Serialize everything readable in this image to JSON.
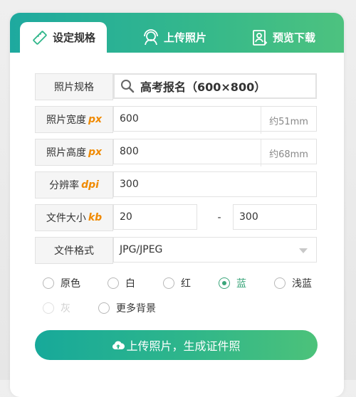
{
  "tabs": [
    {
      "label": "设定规格",
      "icon": "ruler-icon",
      "active": true
    },
    {
      "label": "上传照片",
      "icon": "avatar-upload-icon",
      "active": false
    },
    {
      "label": "预览下载",
      "icon": "id-photo-icon",
      "active": false
    }
  ],
  "form": {
    "spec": {
      "label": "照片规格",
      "value": "高考报名（600×800）",
      "icon": "search-icon"
    },
    "width": {
      "label": "照片宽度",
      "unit": "px",
      "value": "600",
      "note": "约51mm"
    },
    "height": {
      "label": "照片高度",
      "unit": "px",
      "value": "800",
      "note": "约68mm"
    },
    "resolution": {
      "label": "分辨率",
      "unit": "dpi",
      "value": "300"
    },
    "filesize": {
      "label": "文件大小",
      "unit": "kb",
      "min": "20",
      "sep": "-",
      "max": "300"
    },
    "format": {
      "label": "文件格式",
      "value": "JPG/JPEG",
      "icon": "caret-down-icon"
    }
  },
  "backgrounds": [
    {
      "label": "原色",
      "checked": false,
      "disabled": false
    },
    {
      "label": "白",
      "checked": false,
      "disabled": false
    },
    {
      "label": "红",
      "checked": false,
      "disabled": false
    },
    {
      "label": "蓝",
      "checked": true,
      "disabled": false
    },
    {
      "label": "浅蓝",
      "checked": false,
      "disabled": false
    },
    {
      "label": "灰",
      "checked": false,
      "disabled": true
    },
    {
      "label": "更多背景",
      "checked": false,
      "disabled": false
    }
  ],
  "cta": {
    "label": "上传照片，生成证件照",
    "icon": "cloud-upload-icon"
  },
  "colors": {
    "accent": "#2fb68a",
    "unit": "#f08a00",
    "checked": "#3aa57a"
  }
}
